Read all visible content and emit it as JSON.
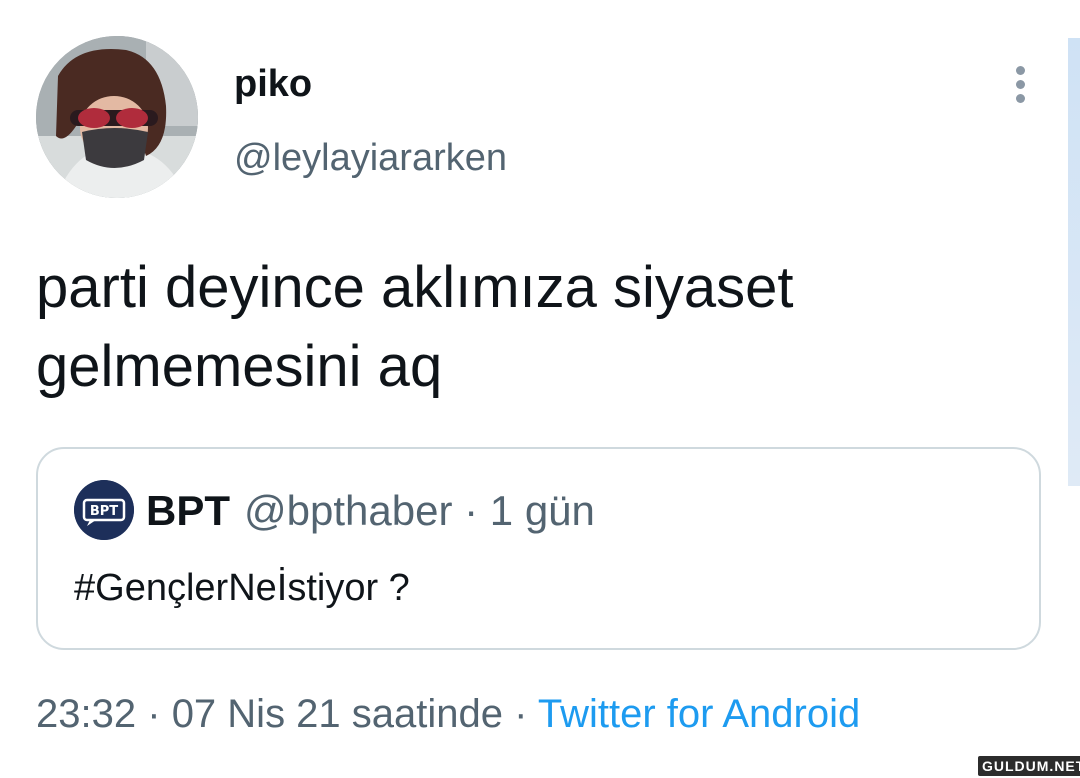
{
  "author": {
    "display_name": "piko",
    "handle": "@leylayiararken"
  },
  "tweet": {
    "text_line1": "parti deyince aklımıza siyaset",
    "text_line2": "gelmemesini aq"
  },
  "quoted": {
    "name": "BPT",
    "handle": "@bpthaber",
    "separator": "·",
    "age": "1 gün",
    "text": "#GençlerNeİstiyor ?"
  },
  "meta": {
    "time": "23:32",
    "date_text": "07 Nis 21 saatinde",
    "separator": "·",
    "source": "Twitter for Android"
  },
  "watermark": "GULDUM.NET",
  "colors": {
    "text_primary": "#0f1419",
    "text_secondary": "#536471",
    "link": "#1d9bf0",
    "border": "#cfd9de"
  }
}
